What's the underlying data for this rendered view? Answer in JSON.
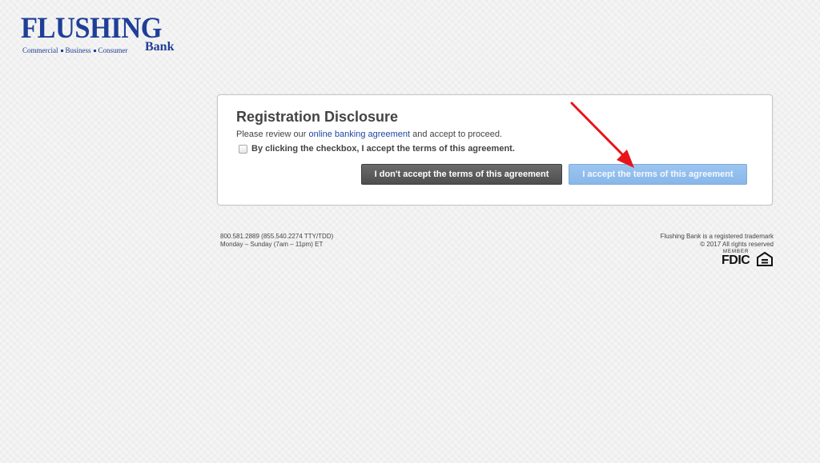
{
  "logo": {
    "word": "FLUSHING",
    "tagline_items": [
      "Commercial",
      "Business",
      "Consumer"
    ],
    "bank": "Bank"
  },
  "disclosure": {
    "title": "Registration Disclosure",
    "text_before": "Please review our ",
    "link_text": "online banking agreement",
    "text_after": " and accept to proceed.",
    "checkbox_label": "By clicking the checkbox, I accept the terms of this agreement.",
    "checkbox_checked": false,
    "decline_label": "I don't accept the terms of this agreement",
    "accept_label": "I accept the terms of this agreement"
  },
  "footer": {
    "phone": "800.581.2889 (855.540.2274 TTY/TDD)",
    "hours": "Monday – Sunday (7am – 11pm) ET",
    "trademark": "Flushing Bank is a registered trademark",
    "copyright": "© 2017 All rights reserved",
    "fdic_member": "MEMBER",
    "fdic_word": "FDIC"
  },
  "colors": {
    "brand_blue": "#1f3f97",
    "link_blue": "#1f47a0",
    "decline_button": "#5a5a5a",
    "accept_button": "#8fbdee",
    "annotation_arrow": "#e8141b"
  },
  "icons": {
    "annotation": "red-arrow-icon",
    "fdic": "equal-housing-lender-icon"
  }
}
